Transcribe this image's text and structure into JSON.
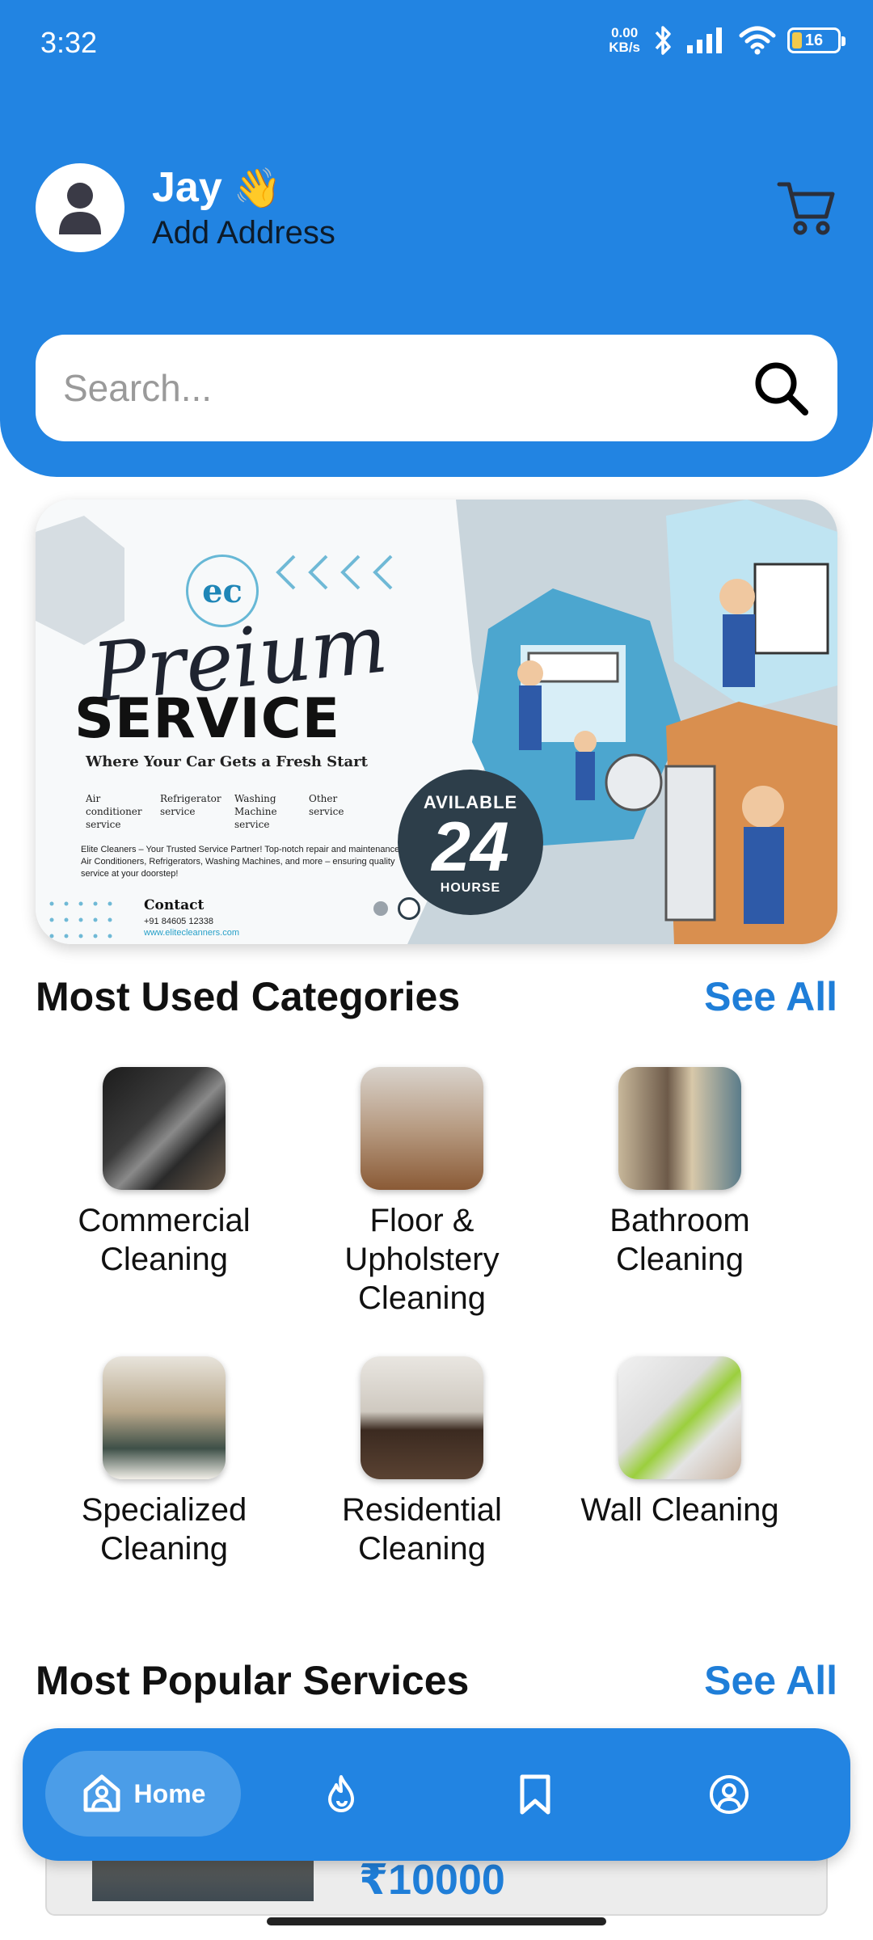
{
  "status_bar": {
    "time": "3:32",
    "net_speed_value": "0.00",
    "net_speed_unit": "KB/s",
    "battery": "16",
    "icons": [
      "bluetooth-icon",
      "signal-icon",
      "wifi-icon",
      "battery-icon"
    ]
  },
  "header": {
    "user_name": "Jay",
    "wave_emoji": "👋",
    "address_label": "Add Address",
    "cart_icon": "cart-icon",
    "accent_color": "#2284e2"
  },
  "search": {
    "placeholder": "Search...",
    "icon": "search-icon"
  },
  "banner": {
    "logo_text": "ec",
    "script_text": "Preium",
    "headline": "SERVICE",
    "tagline": "Where Your Car Gets a Fresh Start",
    "services": [
      "Air conditioner service",
      "Refrigerator service",
      "Washing Machine service",
      "Other service"
    ],
    "description": "Elite Cleaners – Your Trusted Service Partner! Top-notch repair and maintenance for Air Conditioners, Refrigerators, Washing Machines, and more – ensuring quality service at your doorstep!",
    "contact_label": "Contact",
    "phone": "+91 84605 12338",
    "website": "www.elitecleanners.com",
    "badge_top": "AVILABLE",
    "badge_number": "24",
    "badge_bottom": "HOURSE",
    "slides": 2,
    "active_slide": 2
  },
  "categories_section": {
    "title": "Most Used Categories",
    "see_all": "See All",
    "items": [
      {
        "label": "Commercial Cleaning"
      },
      {
        "label": "Floor & Upholstery Cleaning"
      },
      {
        "label": "Bathroom Cleaning"
      },
      {
        "label": "Specialized Cleaning"
      },
      {
        "label": "Residential Cleaning"
      },
      {
        "label": "Wall Cleaning"
      }
    ]
  },
  "popular_section": {
    "title": "Most Popular Services",
    "see_all": "See All",
    "first_price": "₹10000"
  },
  "bottom_nav": {
    "home_label": "Home",
    "items": [
      "home-icon",
      "fire-icon",
      "bookmark-icon",
      "profile-icon"
    ]
  }
}
